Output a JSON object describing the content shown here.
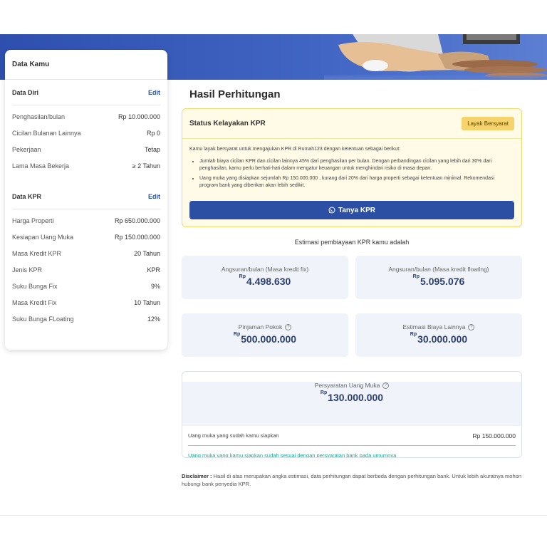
{
  "left": {
    "title": "Data Kamu",
    "data_diri": {
      "title": "Data Diri",
      "edit": "Edit",
      "rows": [
        {
          "label": "Penghasilan/bulan",
          "value": "Rp 10.000.000"
        },
        {
          "label": "Cicilan Bulanan Lainnya",
          "value": "Rp 0"
        },
        {
          "label": "Pekerjaan",
          "value": "Tetap"
        },
        {
          "label": "Lama Masa Bekerja",
          "value": "≥ 2 Tahun"
        }
      ]
    },
    "data_kpr": {
      "title": "Data KPR",
      "edit": "Edit",
      "rows": [
        {
          "label": "Harga Properti",
          "value": "Rp 650.000.000"
        },
        {
          "label": "Kesiapan Uang Muka",
          "value": "Rp 150.000.000"
        },
        {
          "label": "Masa Kredit KPR",
          "value": "20 Tahun"
        },
        {
          "label": "Jenis KPR",
          "value": "KPR"
        },
        {
          "label": "Suku Bunga Fix",
          "value": "9%"
        },
        {
          "label": "Masa Kredit Fix",
          "value": "10 Tahun"
        },
        {
          "label": "Suku Bunga FLoating",
          "value": "12%"
        }
      ]
    }
  },
  "main": {
    "title": "Hasil Perhitungan",
    "status": {
      "title": "Status Kelayakan KPR",
      "badge": "Layak Bersyarat",
      "intro": "Kamu layak bersyarat untuk mengajukan KPR di Rumah123 dengan ketentuan sebagai berikut:",
      "points": [
        "Jumlah biaya cicilan KPR dan cicilan lainnya 45% dari penghasilan per bulan. Dengan perbandingan cicilan yang lebih dari 30% dari penghasilan, kamu perlu berhati-hati dalam mengatur keuangan untuk menghindari risiko di masa depan.",
        "Uang muka yang disiapkan sejumlah Rp 150.000.000 , kurang dari 20% dari harga properti sebagai ketentuan minimal. Rekomendasi program bank yang diberikan akan lebih sedikit."
      ],
      "button": "Tanya KPR"
    },
    "estimasi_label": "Estimasi pembiayaan KPR kamu adalah",
    "currency": "Rp",
    "stats": [
      {
        "label": "Angsuran/bulan (Masa kredit fix)",
        "value": "4.498.630"
      },
      {
        "label": "Angsuran/bulan (Masa kredit floating)",
        "value": "5.095.076"
      },
      {
        "label": "Pinjaman Pokok",
        "value": "500.000.000"
      },
      {
        "label": "Estimasi Biaya Lainnya",
        "value": "30.000.000"
      }
    ],
    "down_payment": {
      "label": "Persyaratan Uang Muka",
      "value": "130.000.000",
      "prepared_label": "Uang muka yang sudah kamu siapkan",
      "prepared_value": "Rp 150.000.000",
      "note": "Uang muka yang kamu siapkan sudah sesuai dengan persyaratan bank pada umumnya"
    },
    "disclaimer_label": "Disclaimer :",
    "disclaimer_text": " Hasil di atas merupakan angka estimasi, data perhitungan dapat berbeda dengan perhitungan bank. Untuk lebih akuratnya mohon hubungi bank penyedia KPR."
  },
  "colors": {
    "primary": "#2d4fa3",
    "badge": "#f7d36e",
    "note": "#1aa58f"
  }
}
